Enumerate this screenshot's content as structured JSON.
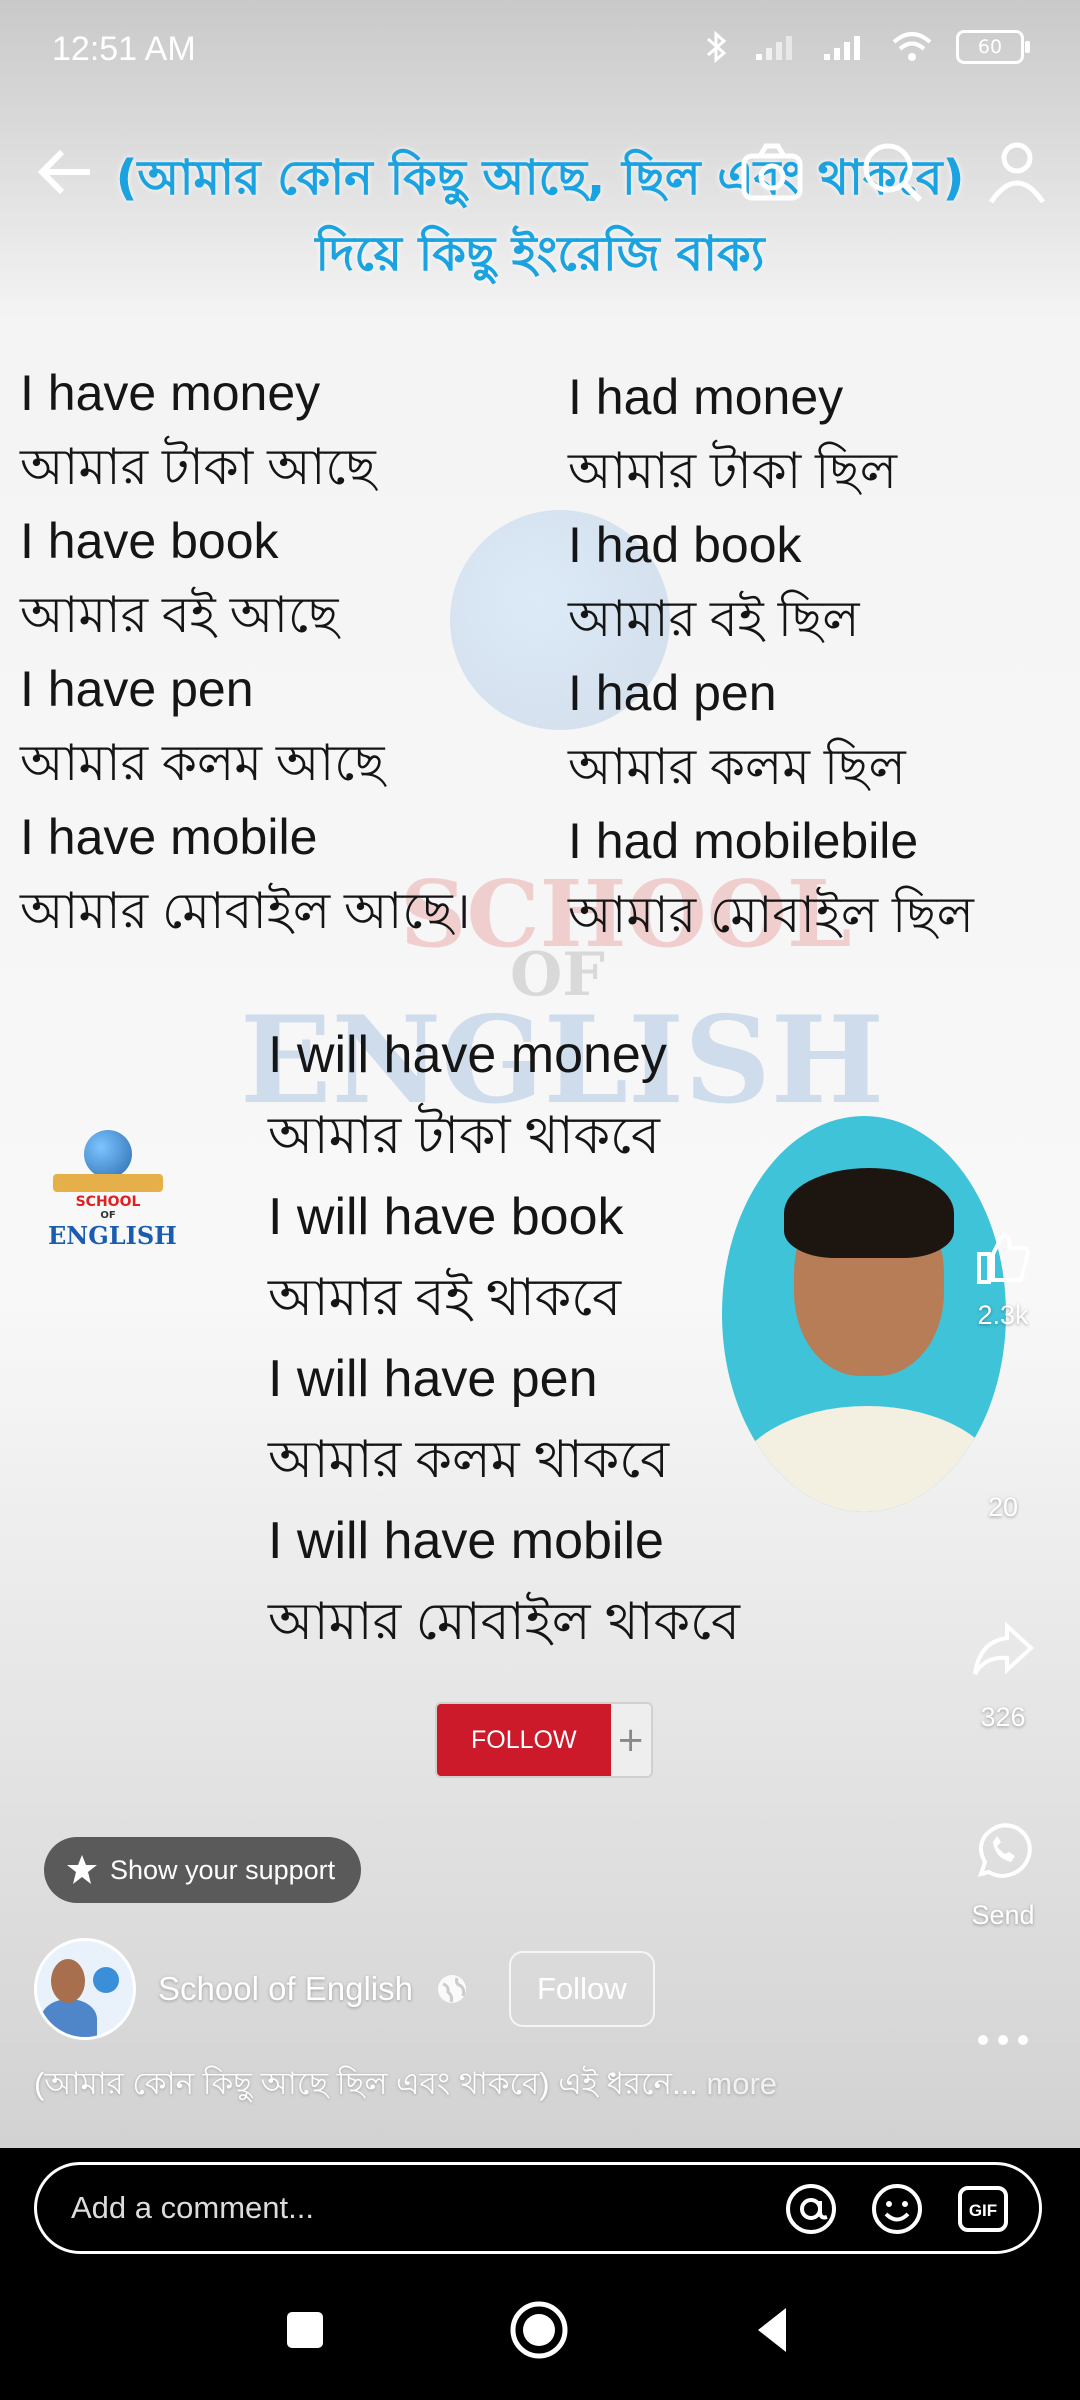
{
  "status_bar": {
    "time": "12:51 AM",
    "battery": "60"
  },
  "video": {
    "title_line1": "(আমার কোন কিছু আছে, ছিল এবং থাকবে)",
    "title_line2": "দিয়ে কিছু ইংরেজি বাক্য",
    "left_column": [
      "I have money",
      "আমার টাকা আছে",
      "I have book",
      "আমার বই আছে",
      "I have pen",
      "আমার কলম আছে",
      "I have mobile",
      "আমার মোবাইল আছে।"
    ],
    "right_column": [
      "I had money",
      "আমার টাকা ছিল",
      "I had book",
      "আমার বই ছিল",
      "I had pen",
      "আমার কলম ছিল",
      "I had mobilebile",
      "আমার মোবাইল ছিল"
    ],
    "bottom_column": [
      "I will have money",
      "আমার টাকা থাকবে",
      "I will have book",
      "আমার বই থাকবে",
      "I will have pen",
      "আমার কলম থাকবে",
      "I will have mobile",
      "আমার মোবাইল থাকবে"
    ],
    "watermark": {
      "line1": "SCHOOL",
      "line2": "OF",
      "line3": "ENGLISH"
    },
    "small_logo": {
      "line1": "SCHOOL",
      "line2": "OF",
      "line3": "ENGLISH"
    },
    "follow_pill_label": "FOLLOW",
    "follow_pill_plus": "+"
  },
  "rail": {
    "likes": "2.3k",
    "comments": "20",
    "shares": "326",
    "send_label": "Send"
  },
  "support_label": "Show your support",
  "owner": {
    "name": "School of English",
    "follow_label": "Follow"
  },
  "caption": {
    "text": "(আমার কোন কিছু আছে ছিল এবং থাকবে) এই ধরনে...",
    "more": "more"
  },
  "comment_box": {
    "placeholder": "Add a comment..."
  },
  "colors": {
    "title_blue": "#1aa3e0",
    "follow_red": "#cc1a2b",
    "presenter_bg": "#3fc3d9"
  },
  "icons": [
    "back-arrow-icon",
    "camera-icon",
    "search-icon",
    "profile-icon",
    "like-icon",
    "comment-icon",
    "share-icon",
    "whatsapp-icon",
    "more-icon",
    "at-icon",
    "emoji-icon",
    "gif-icon",
    "recents-icon",
    "home-icon",
    "back-icon"
  ]
}
